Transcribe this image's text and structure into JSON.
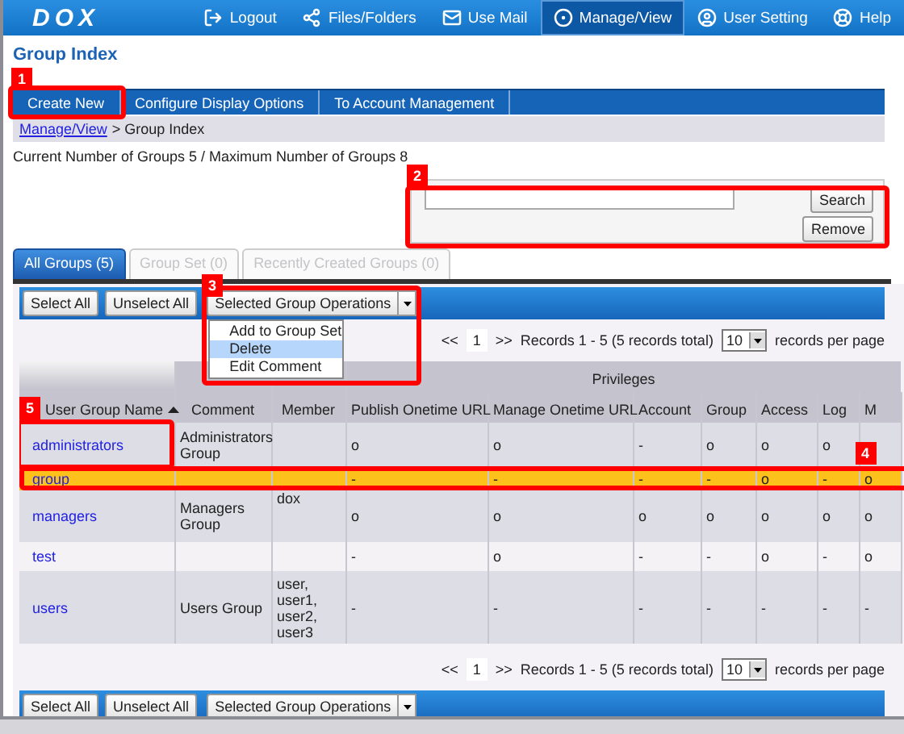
{
  "header": {
    "logo": "DOX",
    "nav": [
      {
        "label": "Logout",
        "selected": false
      },
      {
        "label": "Files/Folders",
        "selected": false
      },
      {
        "label": "Use Mail",
        "selected": false
      },
      {
        "label": "Manage/View",
        "selected": true
      },
      {
        "label": "User Setting",
        "selected": false
      },
      {
        "label": "Help",
        "selected": false
      }
    ]
  },
  "title": "Group Index",
  "toolbar": [
    {
      "label": "Create New",
      "callout": "1"
    },
    {
      "label": "Configure Display Options"
    },
    {
      "label": "To Account Management"
    }
  ],
  "breadcrumb": {
    "link": "Manage/View",
    "current": "> Group Index"
  },
  "summary": "Current Number of Groups 5 / Maximum Number of Groups 8",
  "search": {
    "callout": "2",
    "buttons": [
      "Search",
      "Remove"
    ]
  },
  "tabs": [
    {
      "label": "All Groups (5)",
      "selected": true,
      "disabled": false
    },
    {
      "label": "Group Set (0)",
      "selected": false,
      "disabled": true
    },
    {
      "label": "Recently Created Groups (0)",
      "selected": false,
      "disabled": true
    }
  ],
  "top_actions": {
    "buttons": [
      "Select All",
      "Unselect All"
    ],
    "operations": "Selected Group Operations",
    "menu": {
      "callout": "3",
      "items": [
        {
          "label": "Add to Group Set",
          "selected": false
        },
        {
          "label": "Delete",
          "selected": true
        },
        {
          "label": "Edit Comment",
          "selected": false
        }
      ]
    }
  },
  "top_pager": {
    "prev": "<<",
    "page": "1",
    "next": ">>",
    "records": "Records 1 - 5 (5 records total)",
    "per_page": "10",
    "per_page_label": "records per page"
  },
  "table": {
    "group_header": "Privileges",
    "columns": [
      {
        "label": "User Group Name",
        "sorted": true
      },
      {
        "label": "Comment",
        "sorted": false
      },
      {
        "label": "Member",
        "sorted": false
      },
      {
        "label": "Publish Onetime URL",
        "sorted": false
      },
      {
        "label": "Manage Onetime URL",
        "sorted": false
      },
      {
        "label": "Account",
        "sorted": false
      },
      {
        "label": "Group",
        "sorted": false
      },
      {
        "label": "Access",
        "sorted": false
      },
      {
        "label": "Log",
        "sorted": false
      },
      {
        "label": "M",
        "sorted": false
      }
    ],
    "rows": [
      {
        "name_callout": "5",
        "selected": false,
        "cells": [
          "administrators",
          "Administrators Group",
          "",
          "o",
          "o",
          "-",
          "o",
          "o",
          "o",
          ""
        ]
      },
      {
        "callout": "4",
        "selected": true,
        "cells": [
          "group",
          "",
          "",
          "-",
          "-",
          "-",
          "-",
          "o",
          "-",
          "o"
        ]
      },
      {
        "selected": false,
        "cells": [
          "managers",
          "Managers Group",
          "dox",
          "o",
          "o",
          "o",
          "o",
          "o",
          "o",
          "o"
        ]
      },
      {
        "selected": false,
        "cells": [
          "test",
          "",
          "",
          "-",
          "o",
          "-",
          "-",
          "o",
          "-",
          "o"
        ]
      },
      {
        "selected": false,
        "cells": [
          "users",
          "Users Group",
          "user,\nuser1,\nuser2,\nuser3",
          "-",
          "-",
          "-",
          "-",
          "-",
          "-",
          "-"
        ]
      }
    ]
  },
  "bottom_pager": {
    "prev": "<<",
    "page": "1",
    "next": ">>",
    "records": "Records 1 - 5 (5 records total)",
    "per_page": "10",
    "per_page_label": "records per page"
  },
  "bottom_actions": {
    "buttons": [
      "Select All",
      "Unselect All"
    ],
    "operations": "Selected Group Operations"
  }
}
